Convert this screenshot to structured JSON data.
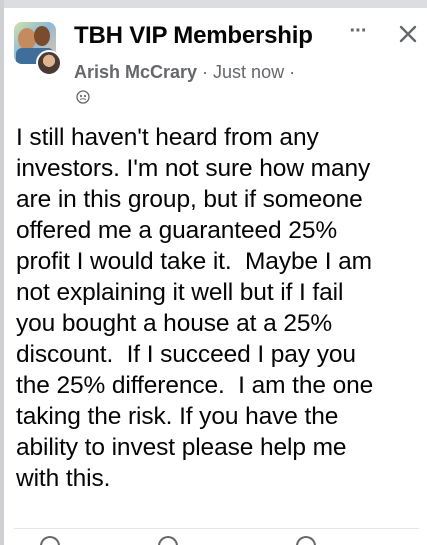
{
  "post": {
    "group_name": "TBH VIP Membership",
    "author": "Arish McCrary",
    "separator": " · ",
    "time": "Just now",
    "trailing_separator": " ·",
    "body": "I still haven't heard from any\ninvestors. I'm not sure how many\nare in this group, but if someone\noffered me a guaranteed 25%\nprofit I would take it.  Maybe I am\nnot explaining it well but if I fail\nyou bought a house at a 25%\ndiscount.  If I succeed I pay you\nthe 25% difference.  I am the one\ntaking the risk. If you have the\nability to invest please help me\nwith this.",
    "more_icon": "···"
  },
  "icons": {
    "more": "more-icon",
    "close": "close-icon",
    "privacy": "globe-icon",
    "group_avatar": "group-avatar",
    "author_avatar": "author-avatar",
    "actions": [
      "like-icon",
      "comment-icon",
      "share-icon"
    ]
  },
  "colors": {
    "text": "#050505",
    "secondary_text": "#65676b",
    "background": "#ffffff"
  }
}
